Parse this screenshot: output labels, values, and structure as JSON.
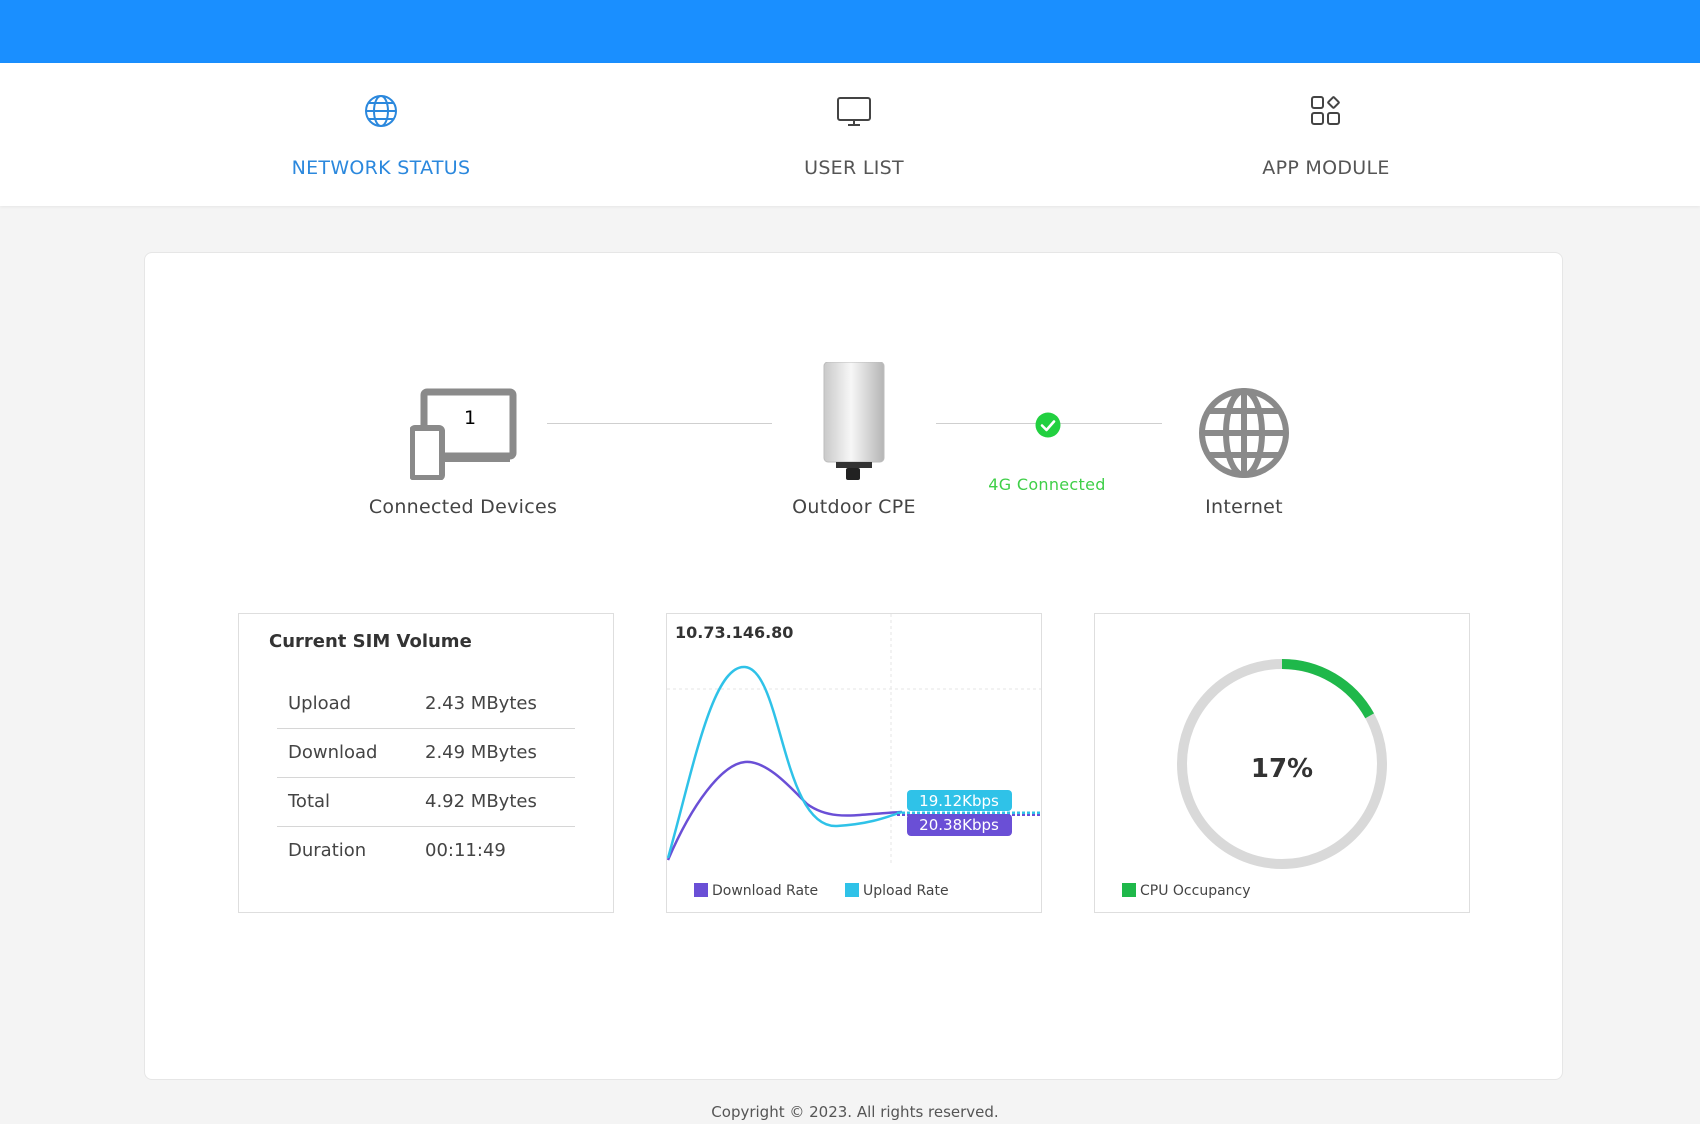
{
  "nav": {
    "tabs": [
      {
        "label": "NETWORK STATUS",
        "icon": "globe-icon",
        "active": true
      },
      {
        "label": "USER LIST",
        "icon": "monitor-icon",
        "active": false
      },
      {
        "label": "APP MODULE",
        "icon": "apps-grid-icon",
        "active": false
      }
    ]
  },
  "topology": {
    "devices": {
      "label": "Connected Devices",
      "count": "1",
      "icon": "devices-icon"
    },
    "cpe": {
      "label": "Outdoor CPE",
      "icon": "outdoor-cpe-icon"
    },
    "link_status": {
      "text": "4G Connected",
      "icon": "check-circle-icon",
      "color": "#3fcf48"
    },
    "internet": {
      "label": "Internet",
      "icon": "globe-icon"
    }
  },
  "sim_volume": {
    "title": "Current SIM Volume",
    "rows": [
      {
        "key": "Upload",
        "value": "2.43 MBytes"
      },
      {
        "key": "Download",
        "value": "2.49 MBytes"
      },
      {
        "key": "Total",
        "value": "4.92 MBytes"
      },
      {
        "key": "Duration",
        "value": "00:11:49"
      }
    ]
  },
  "rate_chart": {
    "ip": "10.73.146.80",
    "upload_label": "19.12Kbps",
    "download_label": "20.38Kbps",
    "legend": {
      "download": "Download Rate",
      "upload": "Upload Rate"
    },
    "colors": {
      "download": "#6a4fd6",
      "upload": "#2fc2e8"
    }
  },
  "cpu": {
    "value_text": "17%",
    "fraction": 0.17,
    "legend": "CPU Occupancy",
    "colors": {
      "fill": "#1fb84a",
      "track": "#d9d9d9"
    }
  },
  "footer": {
    "text": "Copyright © 2023. All rights reserved."
  },
  "theme": {
    "primary": "#1a8fff",
    "active_tab": "#2b88dd"
  },
  "chart_data": {
    "type": "line",
    "series": [
      {
        "name": "Download Rate",
        "color": "#6a4fd6"
      },
      {
        "name": "Upload Rate",
        "color": "#2fc2e8"
      }
    ],
    "title": "10.73.146.80"
  }
}
